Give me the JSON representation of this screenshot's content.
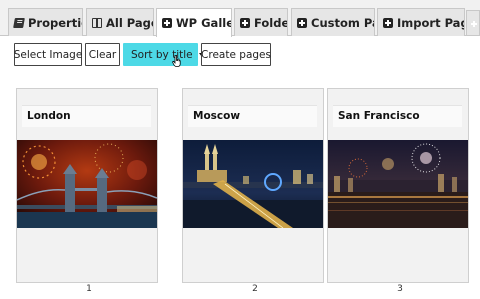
{
  "tabs": [
    {
      "label": "Properties",
      "icon": "book-icon"
    },
    {
      "label": "All Pages",
      "icon": "columns-icon"
    },
    {
      "label": "WP Gallery",
      "icon": "plus-square-icon",
      "active": true
    },
    {
      "label": "Folder",
      "icon": "plus-square-icon"
    },
    {
      "label": "Custom Page",
      "icon": "plus-square-icon"
    },
    {
      "label": "Import Pages",
      "icon": "plus-square-icon"
    }
  ],
  "toolbar": {
    "select_image": "Select Image",
    "clear": "Clear",
    "sort_by_title": "Sort by title",
    "create_pages": "Create pages",
    "accent_color": "#4dd9e6"
  },
  "gallery": [
    {
      "title": "London",
      "number": "1"
    },
    {
      "title": "Moscow",
      "number": "2"
    },
    {
      "title": "San Francisco",
      "number": "3"
    }
  ]
}
